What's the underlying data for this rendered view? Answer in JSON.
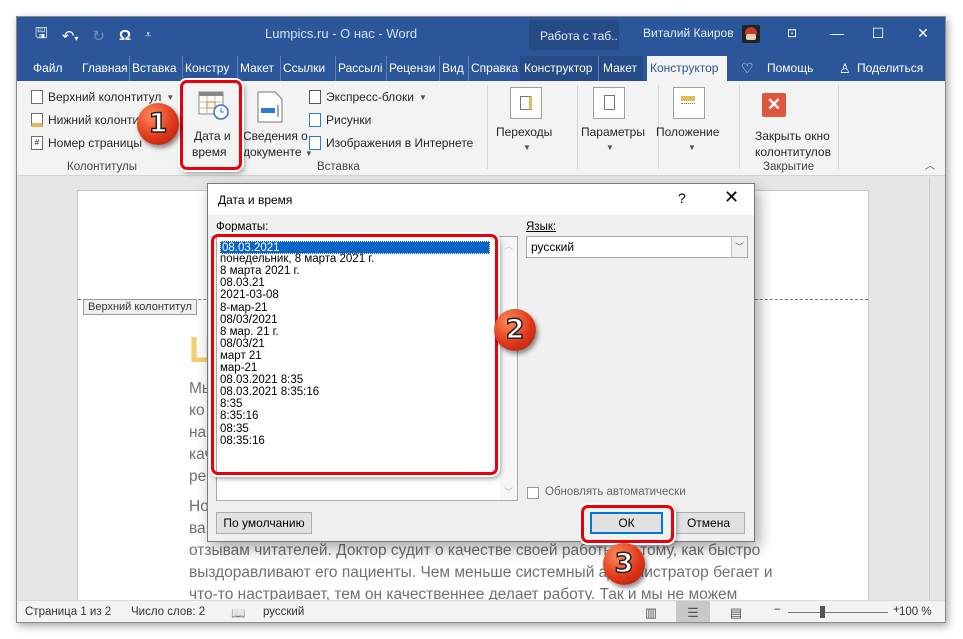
{
  "window": {
    "doc_title": "Lumpics.ru - О нас  -  Word",
    "context_title": "Работа с таб...",
    "user_name": "Виталий Каиров",
    "qat_icons": [
      "save-icon",
      "undo-icon",
      "redo-icon",
      "omega-symbol-icon",
      "customize-qat-icon"
    ],
    "controls": {
      "ribbon_display": "⊡",
      "minimize": "—",
      "maximize": "☐",
      "close": "✕"
    }
  },
  "tabs": [
    {
      "label": "Файл"
    },
    {
      "label": "Главная"
    },
    {
      "label": "Вставка"
    },
    {
      "label": "Констру"
    },
    {
      "label": "Макет"
    },
    {
      "label": "Ссылки"
    },
    {
      "label": "Рассылі"
    },
    {
      "label": "Рецензи"
    },
    {
      "label": "Вид"
    },
    {
      "label": "Справка"
    },
    {
      "label": "Конструктор"
    },
    {
      "label": "Макет"
    },
    {
      "label": "Конструктор"
    },
    {
      "label": "Помощь"
    },
    {
      "label": "Поделиться"
    }
  ],
  "ribbon": {
    "header_footer_group": {
      "header": "Верхний колонтитул",
      "footer": "Нижний колонтитул",
      "page_number": "Номер страницы",
      "label": "Колонтитулы"
    },
    "insert_group": {
      "date_time_line1": "Дата и",
      "date_time_line2": "время",
      "doc_info_line1": "Сведения о",
      "doc_info_line2": "документе",
      "quick_parts": "Экспресс-блоки",
      "pictures": "Рисунки",
      "online_pictures": "Изображения в Интернете",
      "label": "Вставка"
    },
    "navigation": "Переходы",
    "options": "Параметры",
    "position": "Положение",
    "close_group": {
      "close_line1": "Закрыть окно",
      "close_line2": "колонтитулов",
      "label": "Закрытие"
    }
  },
  "document": {
    "header_tag": "Верхний колонтитул",
    "heading_fragment": "Ц",
    "paragraph1": [
      "Мы ... ливает",
      "ко ... е",
      "на ... о",
      "кач",
      "ре"
    ],
    "paragraph2": [
      "Но ... у",
      "ва ... по",
      "отзывам читателей. Доктор судит о качестве своей работы по тому, как быстро",
      "выздоравливают его пациенты. Чем меньше системный администратор бегает и",
      "что-то настраивает, тем он качественнее делает работу. Так и мы не можем"
    ]
  },
  "dialog": {
    "title": "Дата и время",
    "help": "?",
    "close": "✕",
    "formats_label": "Форматы:",
    "formats": [
      "08.03.2021",
      "понедельник, 8 марта 2021 г.",
      "8 марта 2021 г.",
      "08.03.21",
      "2021-03-08",
      "8-мар-21",
      "08/03/2021",
      "8 мар. 21 г.",
      "08/03/21",
      "март 21",
      "мар-21",
      "08.03.2021 8:35",
      "08.03.2021 8:35:16",
      "8:35",
      "8:35:16",
      "08:35",
      "08:35:16"
    ],
    "selected_format_index": 0,
    "language_label": "Язык:",
    "language_value": "русский",
    "auto_update_label": "Обновлять автоматически",
    "auto_update_checked": false,
    "default_button": "По умолчанию",
    "ok_button": "ОК",
    "cancel_button": "Отмена"
  },
  "statusbar": {
    "page": "Страница 1 из 2",
    "words": "Число слов: 2",
    "language": "русский",
    "zoom_percent": "100 %",
    "zoom_minus": "−",
    "zoom_plus": "+"
  },
  "annotations": {
    "step1": "1",
    "step2": "2",
    "step3": "3",
    "highlight_color": "#e8000b"
  }
}
